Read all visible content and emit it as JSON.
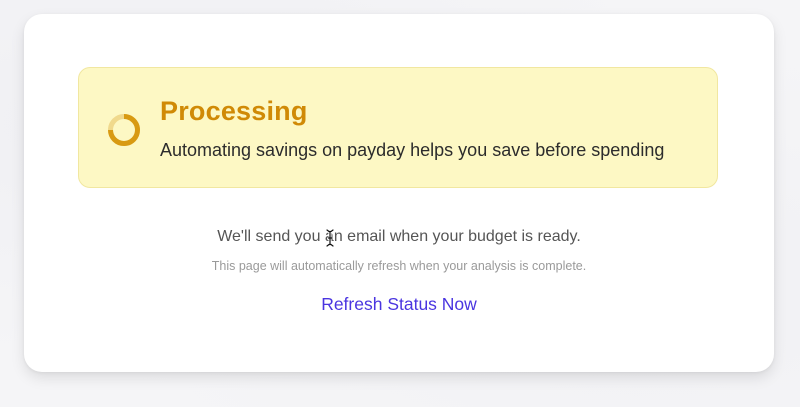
{
  "status_banner": {
    "title": "Processing",
    "message": "Automating savings on payday helps you save before spending",
    "icon": "loading-spinner-icon",
    "accent_color": "#d08a06",
    "background_color": "#fdf8c4"
  },
  "email_note": "We'll send you an email when your budget is ready.",
  "refresh_note": "This page will automatically refresh when your analysis is complete.",
  "refresh_link": {
    "label": "Refresh Status Now",
    "color": "#4a35e0"
  },
  "cursor": {
    "icon": "text-cursor-icon"
  }
}
